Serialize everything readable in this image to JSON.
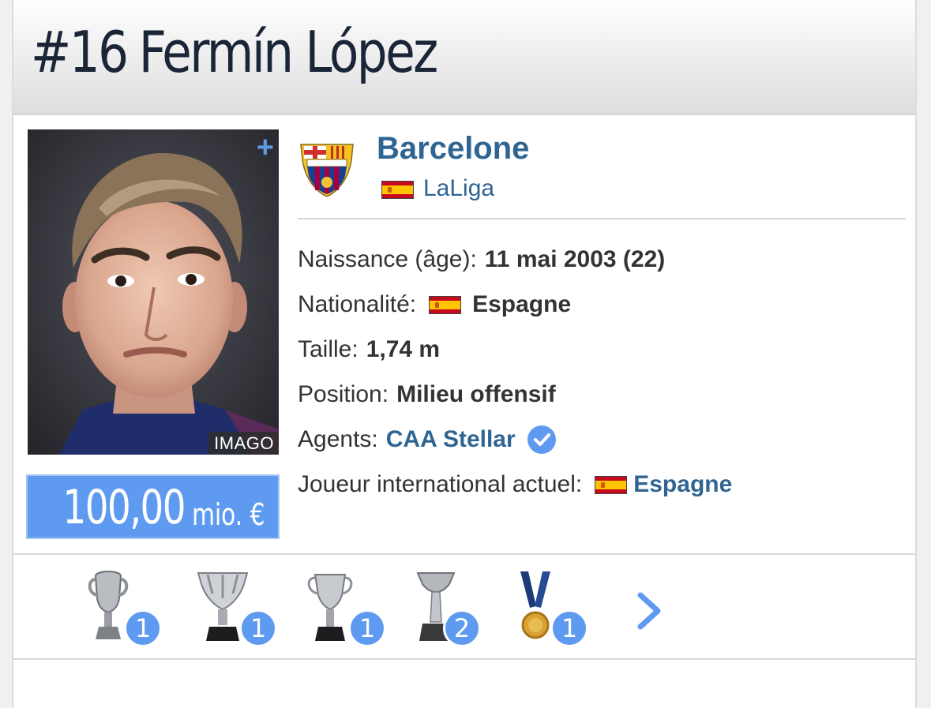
{
  "player": {
    "number": "#16",
    "name": "Fermín López",
    "photo_credit": "IMAGO",
    "photo_plus": "+"
  },
  "market_value": {
    "amount": "100,00",
    "unit": "mio. €"
  },
  "club": {
    "name": "Barcelone",
    "league": "LaLiga"
  },
  "details": {
    "birth_label": "Naissance (âge):",
    "birth_value": "11 mai 2003 (22)",
    "nationality_label": "Nationalité:",
    "nationality_value": "Espagne",
    "height_label": "Taille:",
    "height_value": "1,74 m",
    "position_label": "Position:",
    "position_value": "Milieu offensif",
    "agents_label": "Agents:",
    "agents_value": "CAA Stellar",
    "international_label": "Joueur international actuel:",
    "international_value": "Espagne"
  },
  "trophies": [
    {
      "icon": "euro-trophy-icon",
      "count": "1"
    },
    {
      "icon": "laliga-trophy-icon",
      "count": "1"
    },
    {
      "icon": "copa-del-rey-trophy-icon",
      "count": "1"
    },
    {
      "icon": "supercopa-trophy-icon",
      "count": "2"
    },
    {
      "icon": "gold-medal-icon",
      "count": "1"
    }
  ],
  "colors": {
    "link": "#2f6592",
    "accent": "#5f9af1",
    "title": "#1a2538"
  }
}
